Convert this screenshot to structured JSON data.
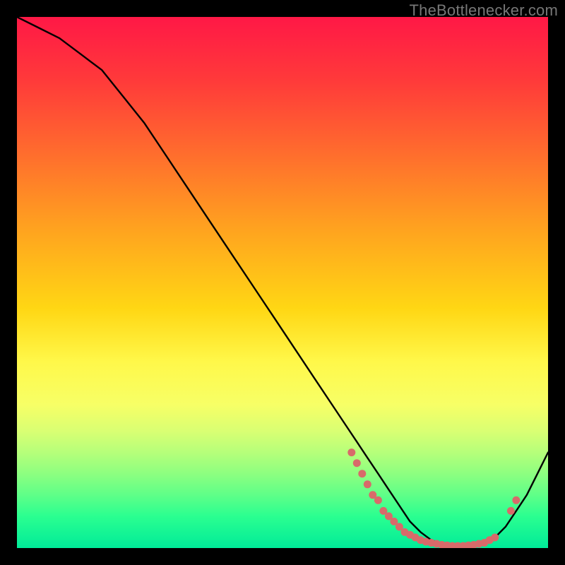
{
  "attribution": "TheBottlenecker.com",
  "colors": {
    "background": "#000000",
    "line": "#000000",
    "marker": "#d86a6a",
    "gradient_top": "#ff1846",
    "gradient_bottom": "#00eb99"
  },
  "chart_data": {
    "type": "line",
    "title": "",
    "xlabel": "",
    "ylabel": "",
    "xlim": [
      0,
      100
    ],
    "ylim": [
      0,
      100
    ],
    "note": "No axis ticks or labels visible; values normalized 0–100. Higher y = higher on chart (red region). Curve estimated from pixels.",
    "series": [
      {
        "name": "curve",
        "x": [
          0,
          4,
          8,
          12,
          16,
          20,
          24,
          28,
          32,
          36,
          40,
          44,
          48,
          52,
          56,
          60,
          62,
          64,
          66,
          68,
          70,
          72,
          74,
          76,
          78,
          80,
          82,
          84,
          86,
          88,
          90,
          92,
          94,
          96,
          98,
          100
        ],
        "values": [
          100,
          98,
          96,
          93,
          90,
          85,
          80,
          74,
          68,
          62,
          56,
          50,
          44,
          38,
          32,
          26,
          23,
          20,
          17,
          14,
          11,
          8,
          5,
          3,
          1.5,
          0.8,
          0.4,
          0.3,
          0.4,
          0.8,
          2,
          4,
          7,
          10,
          14,
          18
        ]
      }
    ],
    "markers": {
      "comment": "Dense cluster of points along the valley floor, roughly x∈[63,95], y near 0–14",
      "points": [
        {
          "x": 63,
          "y": 18
        },
        {
          "x": 64,
          "y": 16
        },
        {
          "x": 65,
          "y": 14
        },
        {
          "x": 66,
          "y": 12
        },
        {
          "x": 67,
          "y": 10
        },
        {
          "x": 68,
          "y": 9
        },
        {
          "x": 69,
          "y": 7
        },
        {
          "x": 70,
          "y": 6
        },
        {
          "x": 71,
          "y": 5
        },
        {
          "x": 72,
          "y": 4
        },
        {
          "x": 73,
          "y": 3
        },
        {
          "x": 74,
          "y": 2.5
        },
        {
          "x": 75,
          "y": 2
        },
        {
          "x": 76,
          "y": 1.5
        },
        {
          "x": 77,
          "y": 1.2
        },
        {
          "x": 78,
          "y": 1
        },
        {
          "x": 79,
          "y": 0.8
        },
        {
          "x": 80,
          "y": 0.6
        },
        {
          "x": 81,
          "y": 0.5
        },
        {
          "x": 82,
          "y": 0.4
        },
        {
          "x": 83,
          "y": 0.4
        },
        {
          "x": 84,
          "y": 0.4
        },
        {
          "x": 85,
          "y": 0.5
        },
        {
          "x": 86,
          "y": 0.6
        },
        {
          "x": 87,
          "y": 0.8
        },
        {
          "x": 88,
          "y": 1
        },
        {
          "x": 89,
          "y": 1.5
        },
        {
          "x": 90,
          "y": 2
        },
        {
          "x": 93,
          "y": 7
        },
        {
          "x": 94,
          "y": 9
        }
      ]
    }
  }
}
